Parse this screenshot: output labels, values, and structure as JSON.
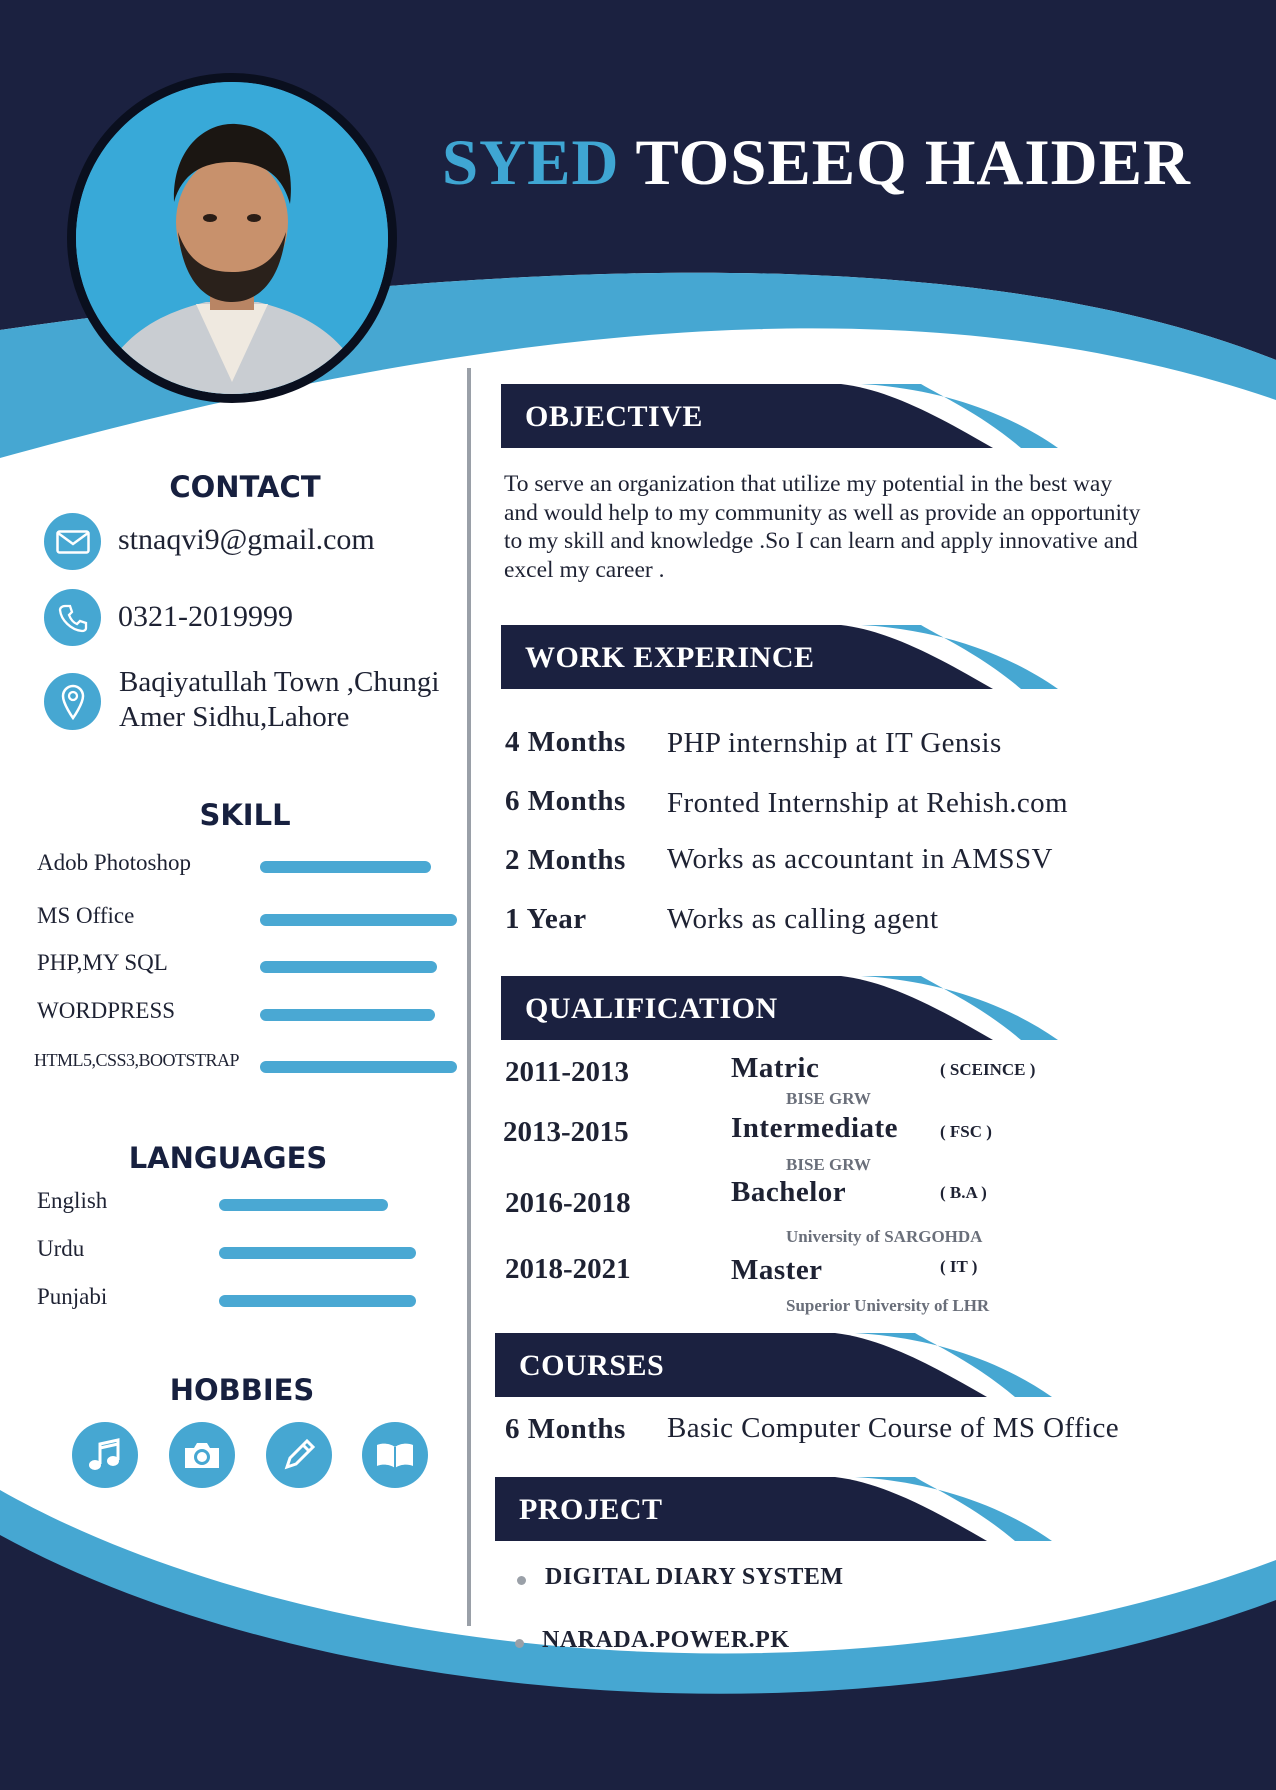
{
  "name": {
    "first": "SYED",
    "rest": "TOSEEQ HAIDER"
  },
  "colors": {
    "navy": "#1b2140",
    "accent": "#46a7d2",
    "white": "#ffffff"
  },
  "contact": {
    "title": "CONTACT",
    "email": "stnaqvi9@gmail.com",
    "phone": "0321-2019999",
    "address_line1": "Baqiyatullah Town ,Chungi",
    "address_line2": "Amer Sidhu,Lahore"
  },
  "skill": {
    "title": "SKILL",
    "items": [
      {
        "label": "Adob Photoshop",
        "level": 0.87
      },
      {
        "label": "MS Office",
        "level": 1.0
      },
      {
        "label": "PHP,MY SQL",
        "level": 0.9
      },
      {
        "label": "WORDPRESS",
        "level": 0.89
      },
      {
        "label": "HTML5,CSS3,BOOTSTRAP",
        "level": 1.0
      }
    ]
  },
  "languages": {
    "title": "LANGUAGES",
    "items": [
      {
        "label": "English",
        "level": 0.86
      },
      {
        "label": "Urdu",
        "level": 1.0
      },
      {
        "label": "Punjabi",
        "level": 1.0
      }
    ]
  },
  "hobbies": {
    "title": "HOBBIES",
    "icons": [
      "music-note-icon",
      "camera-icon",
      "pencil-icon",
      "book-icon"
    ]
  },
  "objective": {
    "title": "OBJECTIVE",
    "lines": [
      "To serve an organization that utilize my potential in the best way",
      "and would help to my community as well as provide an opportunity",
      " to my skill and knowledge .So I can learn and apply innovative and",
      " excel my career ."
    ]
  },
  "work": {
    "title": "WORK EXPERINCE",
    "items": [
      {
        "duration": "4 Months",
        "desc": "PHP internship at IT Gensis"
      },
      {
        "duration": "6 Months",
        "desc": "Fronted Internship at Rehish.com"
      },
      {
        "duration": "2 Months",
        "desc": "Works as accountant in AMSSV"
      },
      {
        "duration": "1 Year",
        "desc": "Works as calling agent"
      }
    ]
  },
  "qualification": {
    "title": "QUALIFICATION",
    "items": [
      {
        "years": "2011-2013",
        "degree": "Matric",
        "field": "( SCEINCE )",
        "institute": "BISE GRW"
      },
      {
        "years": "2013-2015",
        "degree": "Intermediate",
        "field": "( FSC )",
        "institute": "BISE GRW"
      },
      {
        "years": "2016-2018",
        "degree": "Bachelor",
        "field": "( B.A )",
        "institute": "University of SARGOHDA"
      },
      {
        "years": "2018-2021",
        "degree": "Master",
        "field": "( IT )",
        "institute": "Superior University of LHR"
      }
    ]
  },
  "courses": {
    "title": "COURSES",
    "items": [
      {
        "duration": "6 Months",
        "desc": "Basic Computer Course of MS Office"
      }
    ]
  },
  "project": {
    "title": "PROJECT",
    "items": [
      "DIGITAL DIARY SYSTEM",
      "NARADA.POWER.PK"
    ]
  }
}
